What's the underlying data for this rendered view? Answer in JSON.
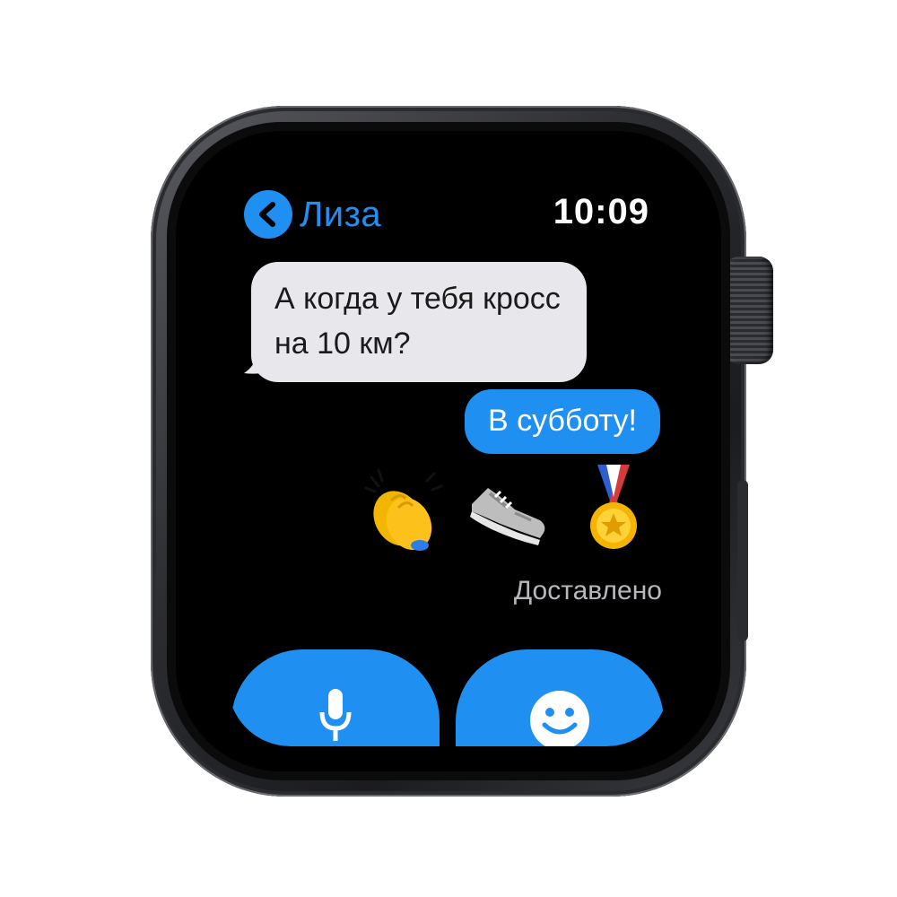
{
  "header": {
    "contact_name": "Лиза",
    "time": "10:09"
  },
  "messages": {
    "incoming_text": "А когда у тебя кросс на 10 км?",
    "outgoing_text": "В субботу!",
    "emojis": [
      "clapping-hands",
      "sneaker",
      "medal"
    ],
    "status": "Доставлено"
  },
  "actions": {
    "dictation_icon": "microphone-icon",
    "emoji_icon": "smiley-icon"
  },
  "colors": {
    "accent": "#1f8ff2",
    "bubble_incoming": "#e8e8ec",
    "background": "#000000",
    "status_text": "#b8b8bc"
  }
}
